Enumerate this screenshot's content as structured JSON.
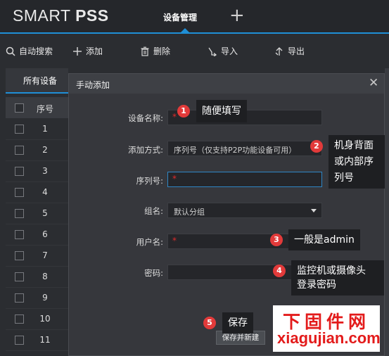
{
  "app": {
    "logo_light": "SMART ",
    "logo_bold": "PSS",
    "active_tab": "设备管理",
    "add_tab_symbol": "+",
    "accent_color": "#1f8fd6"
  },
  "toolbar": {
    "search_label": "自动搜索",
    "add_label": "添加",
    "delete_label": "删除",
    "import_label": "导入",
    "export_label": "导出"
  },
  "device_list": {
    "tab_label": "所有设备",
    "col_index": "序号",
    "rows": [
      "1",
      "2",
      "3",
      "4",
      "5",
      "6",
      "7",
      "8",
      "9",
      "10",
      "11"
    ]
  },
  "dialog": {
    "title": "手动添加",
    "close_symbol": "✕",
    "device_name_label": "设备名称:",
    "add_method_label": "添加方式:",
    "add_method_value": "序列号（仅支持P2P功能设备可用）",
    "serial_label": "序列号:",
    "group_label": "组名:",
    "group_value": "默认分组",
    "username_label": "用户名:",
    "password_label": "密码:",
    "required_mark": "*",
    "save_new_label": "保存并新建"
  },
  "annotations": [
    {
      "num": "1",
      "text": "随便填写"
    },
    {
      "num": "2",
      "text": "机身背面\n或内部序\n列号"
    },
    {
      "num": "3",
      "text": "一般是admin"
    },
    {
      "num": "4",
      "text": "监控机或摄像头\n登录密码"
    },
    {
      "num": "5",
      "text": "保存"
    }
  ],
  "watermark": {
    "cn": "下固件网",
    "en": "xiagujian.com"
  }
}
